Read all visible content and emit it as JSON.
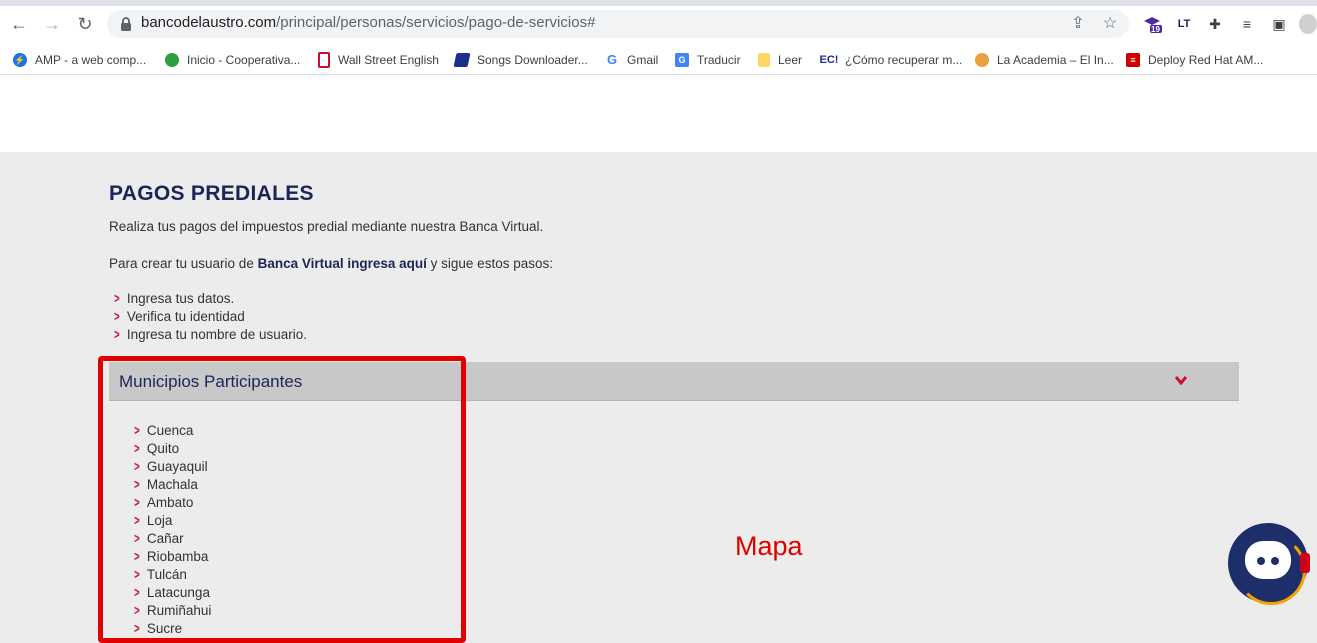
{
  "browser": {
    "url_domain": "bancodelaustro.com",
    "url_path": "/principal/personas/servicios/pago-de-servicios#",
    "ext_badge": "19",
    "ext_lt": "LT",
    "bookmarks": [
      {
        "label": "AMP - a web comp...",
        "icon": "amp-icon",
        "color": "#1a73e8"
      },
      {
        "label": "Inicio - Cooperativa...",
        "icon": "coop-icon",
        "color": "#2e9e3e"
      },
      {
        "label": "Wall Street English",
        "icon": "wse-icon",
        "color": "#ffffff"
      },
      {
        "label": "Songs Downloader...",
        "icon": "songs-icon",
        "color": "#1d2e8f"
      },
      {
        "label": "Gmail",
        "icon": "google-icon",
        "color": "#ffffff"
      },
      {
        "label": "Traducir",
        "icon": "translate-icon",
        "color": "#4285f4"
      },
      {
        "label": "Leer",
        "icon": "folder-icon",
        "color": "#fdd663"
      },
      {
        "label": "¿Cómo recuperar m...",
        "icon": "ec-icon",
        "color": "#ffffff"
      },
      {
        "label": "La Academia – El In...",
        "icon": "academia-icon",
        "color": "#e8a13c"
      },
      {
        "label": "Deploy Red Hat AM...",
        "icon": "redhat-icon",
        "color": "#cc0000"
      }
    ],
    "ec_label": "EC!"
  },
  "page": {
    "title": "PAGOS PREDIALES",
    "intro": "Realiza tus pagos del impuestos predial mediante nuestra Banca Virtual.",
    "create_prefix": "Para crear tu usuario de ",
    "create_link": "Banca Virtual ingresa aquí",
    "create_suffix": " y sigue estos pasos:",
    "steps": [
      "Ingresa tus datos.",
      "Verifica tu identidad",
      "Ingresa tu nombre de usuario."
    ],
    "accordion_title": "Municipios Participantes",
    "municipios": [
      "Cuenca",
      "Quito",
      "Guayaquil",
      "Machala",
      "Ambato",
      "Loja",
      "Cañar",
      "Riobamba",
      "Tulcán",
      "Latacunga",
      "Rumiñahui",
      "Sucre"
    ],
    "annotation": "Mapa"
  },
  "colors": {
    "brand_navy": "#1d2556",
    "accent_red": "#c8102e",
    "annotation_red": "#e00000"
  }
}
